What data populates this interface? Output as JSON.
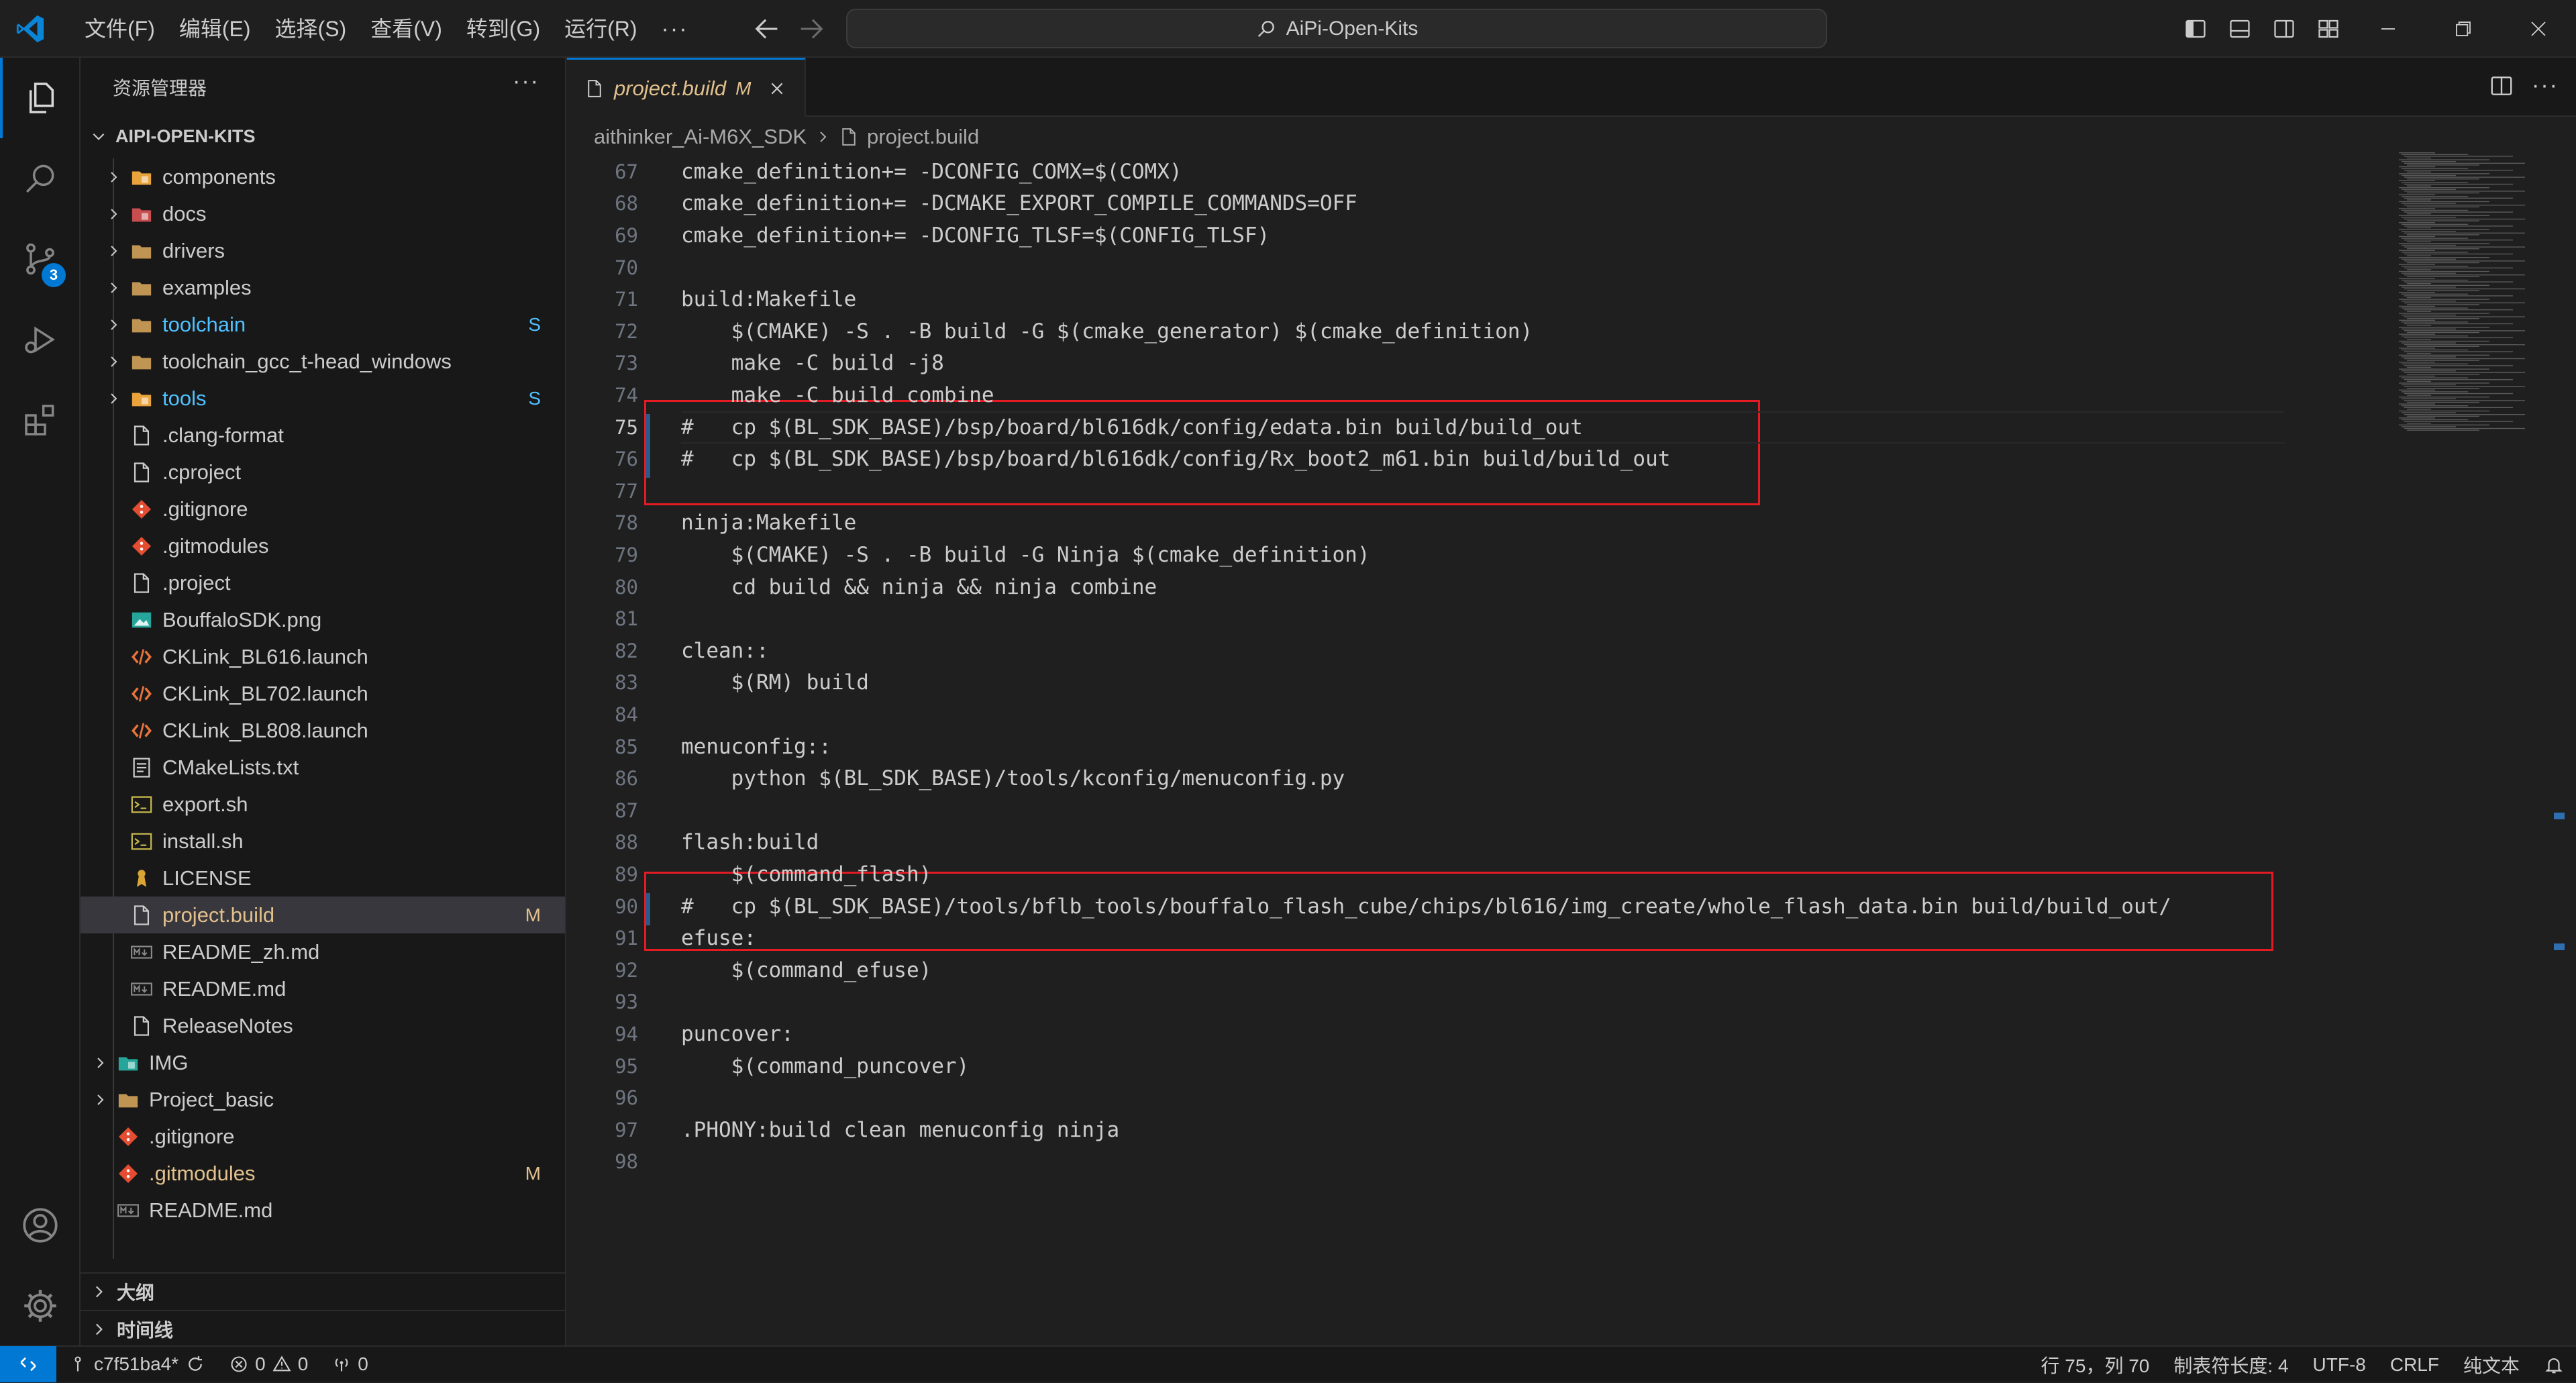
{
  "titlebar": {
    "menu": [
      "文件(F)",
      "编辑(E)",
      "选择(S)",
      "查看(V)",
      "转到(G)",
      "运行(R)"
    ],
    "more": "···",
    "search_text": "AiPi-Open-Kits"
  },
  "activity": {
    "scm_badge": "3"
  },
  "sidebar": {
    "title": "资源管理器",
    "more": "···",
    "root": "AIPI-OPEN-KITS",
    "items": [
      {
        "label": "components",
        "type": "folder",
        "indent": 1,
        "expand": true,
        "icon": "components-folder-icon",
        "icon_color": "#e8a33d",
        "status": ""
      },
      {
        "label": "docs",
        "type": "folder",
        "indent": 1,
        "expand": true,
        "icon": "docs-folder-icon",
        "icon_color": "#c74e4e",
        "status": ""
      },
      {
        "label": "drivers",
        "type": "folder",
        "indent": 1,
        "expand": true,
        "icon": "folder-icon",
        "icon_color": "#c09553",
        "status": ""
      },
      {
        "label": "examples",
        "type": "folder",
        "indent": 1,
        "expand": true,
        "icon": "folder-icon",
        "icon_color": "#c09553",
        "status": ""
      },
      {
        "label": "toolchain",
        "type": "folder",
        "indent": 1,
        "expand": true,
        "icon": "folder-icon",
        "icon_color": "#c09553",
        "status": "S",
        "color": "blue"
      },
      {
        "label": "toolchain_gcc_t-head_windows",
        "type": "folder",
        "indent": 1,
        "expand": true,
        "icon": "folder-icon",
        "icon_color": "#c09553",
        "status": ""
      },
      {
        "label": "tools",
        "type": "folder",
        "indent": 1,
        "expand": true,
        "icon": "tools-folder-icon",
        "icon_color": "#e8a33d",
        "status": "S",
        "color": "blue"
      },
      {
        "label": ".clang-format",
        "type": "file",
        "indent": 1,
        "icon": "file-icon",
        "status": ""
      },
      {
        "label": ".cproject",
        "type": "file",
        "indent": 1,
        "icon": "file-icon",
        "status": ""
      },
      {
        "label": ".gitignore",
        "type": "file",
        "indent": 1,
        "icon": "git-icon",
        "status": ""
      },
      {
        "label": ".gitmodules",
        "type": "file",
        "indent": 1,
        "icon": "git-icon",
        "status": ""
      },
      {
        "label": ".project",
        "type": "file",
        "indent": 1,
        "icon": "file-icon",
        "status": ""
      },
      {
        "label": "BouffaloSDK.png",
        "type": "file",
        "indent": 1,
        "icon": "image-icon",
        "status": ""
      },
      {
        "label": "CKLink_BL616.launch",
        "type": "file",
        "indent": 1,
        "icon": "xml-icon",
        "status": ""
      },
      {
        "label": "CKLink_BL702.launch",
        "type": "file",
        "indent": 1,
        "icon": "xml-icon",
        "status": ""
      },
      {
        "label": "CKLink_BL808.launch",
        "type": "file",
        "indent": 1,
        "icon": "xml-icon",
        "status": ""
      },
      {
        "label": "CMakeLists.txt",
        "type": "file",
        "indent": 1,
        "icon": "text-file-icon",
        "status": ""
      },
      {
        "label": "export.sh",
        "type": "file",
        "indent": 1,
        "icon": "terminal-icon",
        "status": ""
      },
      {
        "label": "install.sh",
        "type": "file",
        "indent": 1,
        "icon": "terminal-icon",
        "status": ""
      },
      {
        "label": "LICENSE",
        "type": "file",
        "indent": 1,
        "icon": "license-icon",
        "status": ""
      },
      {
        "label": "project.build",
        "type": "file",
        "indent": 1,
        "icon": "file-icon",
        "status": "M",
        "color": "mod",
        "selected": true
      },
      {
        "label": "README_zh.md",
        "type": "file",
        "indent": 1,
        "icon": "markdown-icon",
        "status": ""
      },
      {
        "label": "README.md",
        "type": "file",
        "indent": 1,
        "icon": "markdown-icon",
        "status": ""
      },
      {
        "label": "ReleaseNotes",
        "type": "file",
        "indent": 1,
        "icon": "file-icon",
        "status": ""
      },
      {
        "label": "IMG",
        "type": "folder",
        "indent": 0,
        "expand": true,
        "icon": "image-folder-icon",
        "icon_color": "#26a69a",
        "status": ""
      },
      {
        "label": "Project_basic",
        "type": "folder",
        "indent": 0,
        "expand": true,
        "icon": "folder-icon",
        "icon_color": "#c09553",
        "status": ""
      },
      {
        "label": ".gitignore",
        "type": "file",
        "indent": 0,
        "icon": "git-icon",
        "status": ""
      },
      {
        "label": ".gitmodules",
        "type": "file",
        "indent": 0,
        "icon": "git-icon",
        "status": "M",
        "color": "mod"
      },
      {
        "label": "README.md",
        "type": "file",
        "indent": 0,
        "icon": "markdown-icon",
        "status": ""
      }
    ],
    "outline": "大纲",
    "timeline": "时间线"
  },
  "editor": {
    "tab_label": "project.build",
    "tab_status": "M",
    "breadcrumb": [
      "aithinker_Ai-M6X_SDK",
      "project.build"
    ],
    "lines": [
      {
        "n": "67",
        "text": "cmake_definition+= -DCONFIG_COMX=$(COMX)"
      },
      {
        "n": "68",
        "text": "cmake_definition+= -DCMAKE_EXPORT_COMPILE_COMMANDS=OFF"
      },
      {
        "n": "69",
        "text": "cmake_definition+= -DCONFIG_TLSF=$(CONFIG_TLSF)"
      },
      {
        "n": "70",
        "text": ""
      },
      {
        "n": "71",
        "text": "build:Makefile"
      },
      {
        "n": "72",
        "text": "    $(CMAKE) -S . -B build -G $(cmake_generator) $(cmake_definition)"
      },
      {
        "n": "73",
        "text": "    make -C build -j8"
      },
      {
        "n": "74",
        "text": "    make -C build combine"
      },
      {
        "n": "75",
        "text": "#   cp $(BL_SDK_BASE)/bsp/board/bl616dk/config/edata.bin build/build_out"
      },
      {
        "n": "76",
        "text": "#   cp $(BL_SDK_BASE)/bsp/board/bl616dk/config/Rx_boot2_m61.bin build/build_out"
      },
      {
        "n": "77",
        "text": ""
      },
      {
        "n": "78",
        "text": "ninja:Makefile"
      },
      {
        "n": "79",
        "text": "    $(CMAKE) -S . -B build -G Ninja $(cmake_definition)"
      },
      {
        "n": "80",
        "text": "    cd build && ninja && ninja combine"
      },
      {
        "n": "81",
        "text": ""
      },
      {
        "n": "82",
        "text": "clean::"
      },
      {
        "n": "83",
        "text": "    $(RM) build"
      },
      {
        "n": "84",
        "text": ""
      },
      {
        "n": "85",
        "text": "menuconfig::"
      },
      {
        "n": "86",
        "text": "    python $(BL_SDK_BASE)/tools/kconfig/menuconfig.py"
      },
      {
        "n": "87",
        "text": ""
      },
      {
        "n": "88",
        "text": "flash:build"
      },
      {
        "n": "89",
        "text": "    $(command_flash)"
      },
      {
        "n": "90",
        "text": "#   cp $(BL_SDK_BASE)/tools/bflb_tools/bouffalo_flash_cube/chips/bl616/img_create/whole_flash_data.bin build/build_out/"
      },
      {
        "n": "91",
        "text": "efuse:"
      },
      {
        "n": "92",
        "text": "    $(command_efuse)"
      },
      {
        "n": "93",
        "text": ""
      },
      {
        "n": "94",
        "text": "puncover:"
      },
      {
        "n": "95",
        "text": "    $(command_puncover)"
      },
      {
        "n": "96",
        "text": ""
      },
      {
        "n": "97",
        "text": ".PHONY:build clean menuconfig ninja"
      },
      {
        "n": "98",
        "text": ""
      }
    ],
    "current_line": "75"
  },
  "statusbar": {
    "branch": "c7f51ba4*",
    "errors": "0",
    "warnings": "0",
    "ports": "0",
    "position": "行 75，列 70",
    "tab_size": "制表符长度: 4",
    "encoding": "UTF-8",
    "eol": "CRLF",
    "language": "纯文本"
  },
  "colors": {
    "accent": "#0078d4",
    "highlight_box": "#e51b24",
    "modified": "#e2c08d",
    "untracked_blue": "#4fc1ff"
  }
}
